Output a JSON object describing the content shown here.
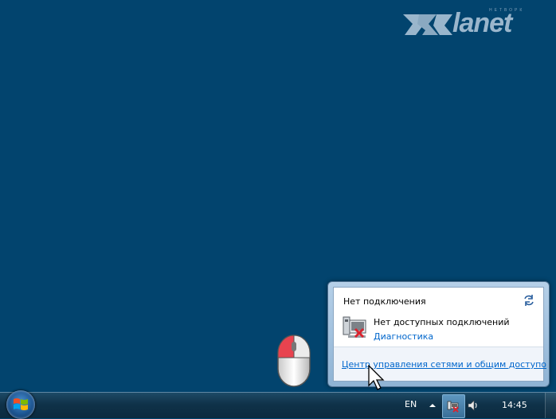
{
  "logo": {
    "brand_text": "lanet",
    "tagline": "НЕТВОРК"
  },
  "flyout": {
    "title": "Нет подключения",
    "status_text": "Нет доступных подключений",
    "diagnostics_link": "Диагностика",
    "network_center_link": "Центр управления сетями и общим доступо"
  },
  "taskbar": {
    "language": "EN",
    "clock": "14:45"
  },
  "icons": {
    "start": "windows-start-orb-icon",
    "refresh": "refresh-icon",
    "network_status": "network-disconnected-icon",
    "tray_network": "tray-network-error-icon",
    "volume": "speaker-icon",
    "mouse": "mouse-left-click-icon",
    "cursor": "mouse-pointer-icon"
  },
  "colors": {
    "desktop": "#02446e",
    "link": "#0066cc",
    "error": "#d9232e"
  }
}
